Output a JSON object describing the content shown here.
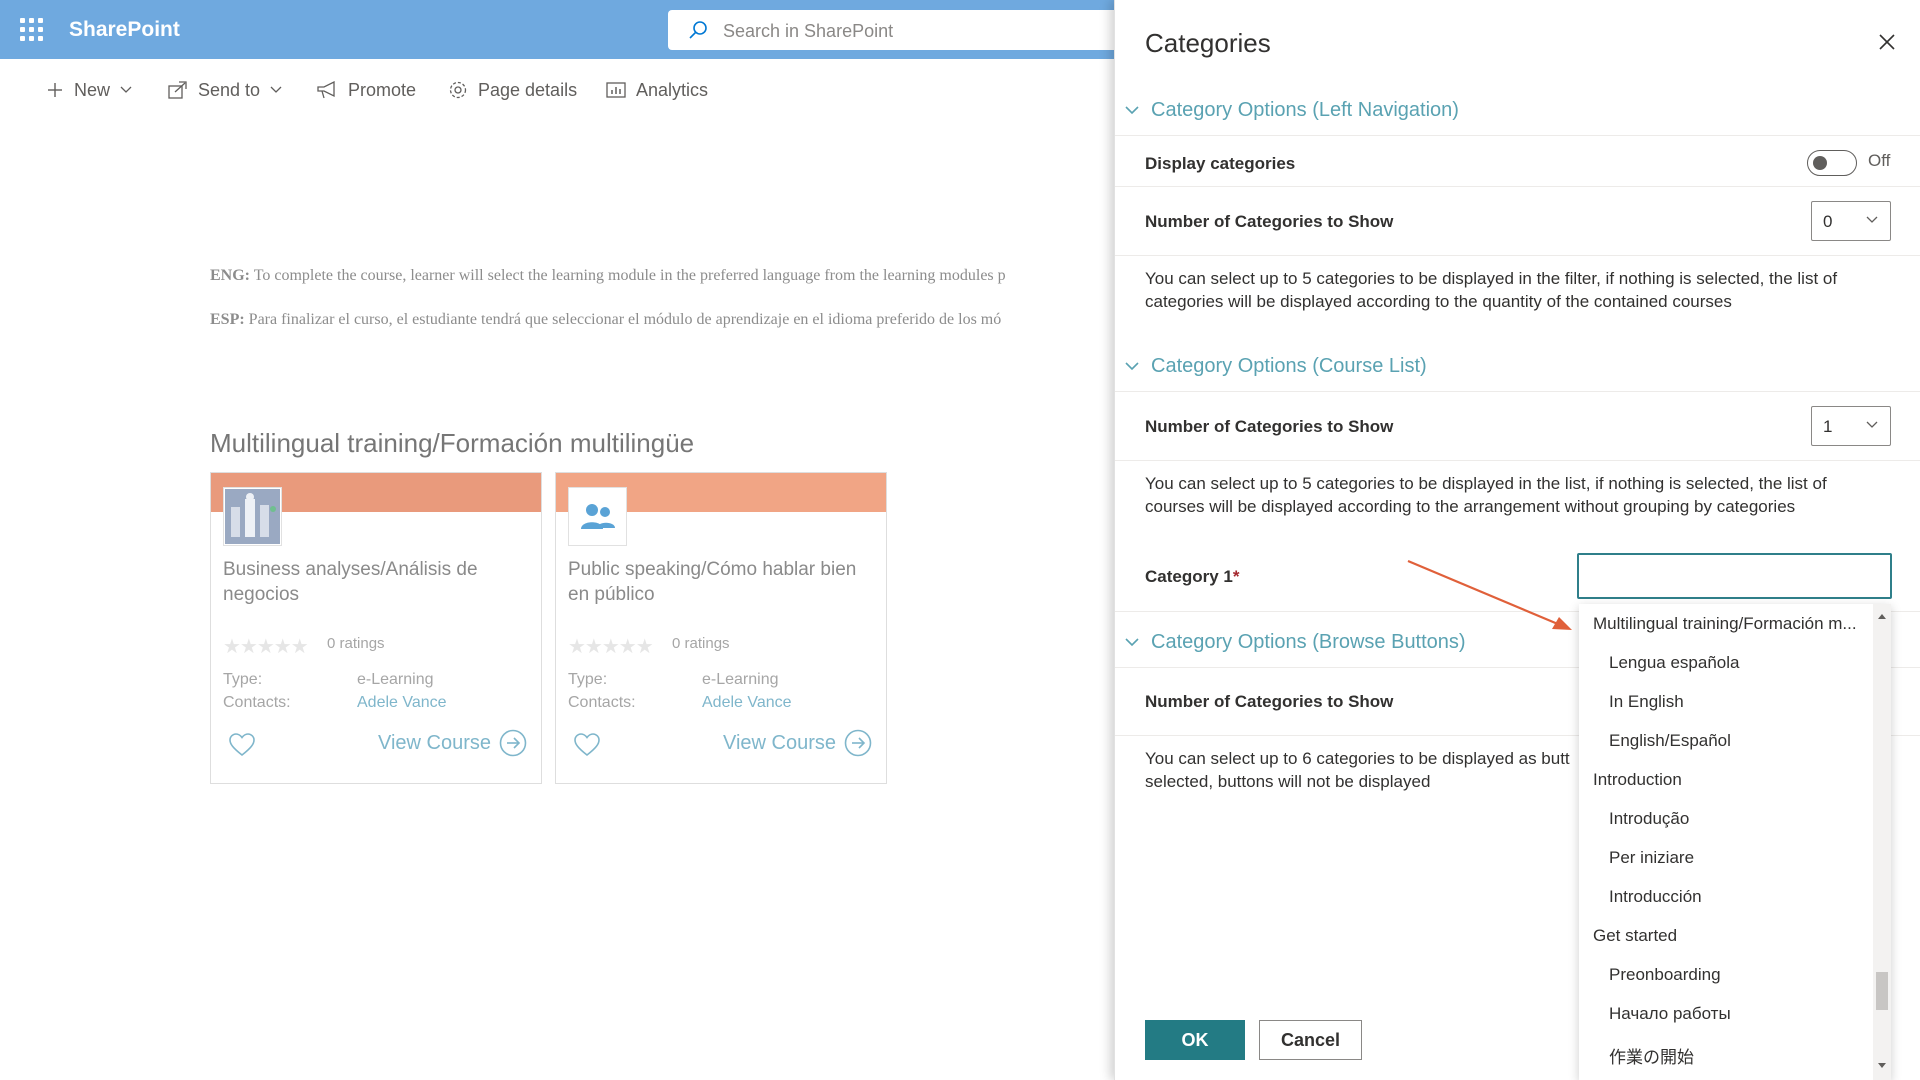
{
  "app": {
    "name": "SharePoint",
    "search_placeholder": "Search in SharePoint"
  },
  "commands": [
    {
      "label": "New",
      "icon": "plus-icon"
    },
    {
      "label": "Send to",
      "icon": "share-icon"
    },
    {
      "label": "Promote",
      "icon": "megaphone-icon"
    },
    {
      "label": "Page details",
      "icon": "gear-icon"
    },
    {
      "label": "Analytics",
      "icon": "chart-icon"
    }
  ],
  "content": {
    "eng_label": "ENG:",
    "eng_text": " To complete the course, learner will select the learning module in the preferred language from the learning modules p",
    "esp_label": "ESP:",
    "esp_text": " Para finalizar el curso, el estudiante tendrá que seleccionar el módulo de aprendizaje en el idioma preferido de los mó",
    "section_title": "Multilingual training/Formación multilingüe",
    "cards": [
      {
        "title": "Business analyses/Análisis de negocios",
        "stars": "★★★★★",
        "ratings": "0 ratings",
        "type_label": "Type:",
        "type_value": "e-Learning",
        "contacts_label": "Contacts:",
        "contacts_value": "Adele Vance",
        "view_label": "View Course"
      },
      {
        "title": "Public speaking/Cómo hablar bien en público",
        "stars": "★★★★★",
        "ratings": "0 ratings",
        "type_label": "Type:",
        "type_value": "e-Learning",
        "contacts_label": "Contacts:",
        "contacts_value": "Adele Vance",
        "view_label": "View Course"
      }
    ]
  },
  "panel": {
    "title": "Categories",
    "groups": [
      {
        "header": "Category Options (Left Navigation)",
        "display_label": "Display categories",
        "toggle_text": "Off",
        "toggle_on": false,
        "count_label": "Number of Categories to Show",
        "count_value": "0",
        "description": "You can select up to 5 categories to be displayed in the filter, if nothing is selected, the list of categories will be displayed according to the quantity of the contained courses"
      },
      {
        "header": "Category Options (Course List)",
        "count_label": "Number of Categories to Show",
        "count_value": "1",
        "description": "You can select up to 5 categories to be displayed in the list, if nothing is selected, the list of courses will be displayed according to the arrangement without grouping by categories",
        "category_label": "Category 1",
        "required_mark": "*",
        "category_value": ""
      },
      {
        "header": "Category Options (Browse Buttons)",
        "count_label": "Number of Categories to Show",
        "description": "You can select up to 6 categories to be displayed as butt selected, buttons will not be displayed"
      }
    ],
    "dropdown_options": [
      {
        "label": "Multilingual training/Formación m...",
        "level": 0
      },
      {
        "label": "Lengua española",
        "level": 1
      },
      {
        "label": "In English",
        "level": 1
      },
      {
        "label": "English/Español",
        "level": 1
      },
      {
        "label": "Introduction",
        "level": 0
      },
      {
        "label": "Introdução",
        "level": 1
      },
      {
        "label": "Per iniziare",
        "level": 1
      },
      {
        "label": "Introducción",
        "level": 1
      },
      {
        "label": "Get started",
        "level": 0
      },
      {
        "label": "Preonboarding",
        "level": 1
      },
      {
        "label": "Начало работы",
        "level": 1
      },
      {
        "label": "作業の開始",
        "level": 1
      }
    ],
    "ok_label": "OK",
    "cancel_label": "Cancel"
  },
  "colors": {
    "suite_bar": "#6fa9df",
    "accent_teal": "#237b84",
    "group_header": "#5aa2b2",
    "card_band": "#e99a7c",
    "annotation_arrow": "#e0603a"
  }
}
